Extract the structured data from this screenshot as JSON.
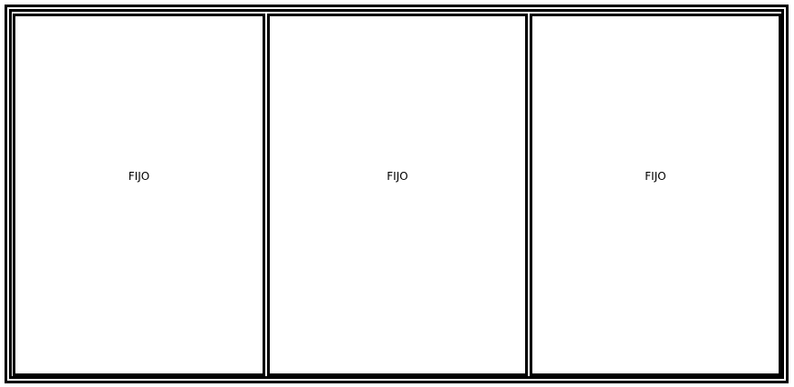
{
  "window": {
    "panes": [
      {
        "label": "FIJO"
      },
      {
        "label": "FIJO"
      },
      {
        "label": "FIJO"
      }
    ]
  }
}
